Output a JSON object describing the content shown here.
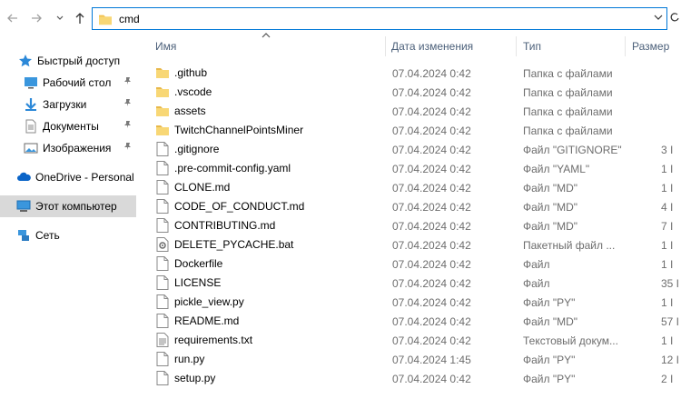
{
  "address": {
    "path": "cmd"
  },
  "nav": {
    "back_icon": "arrow-left-icon",
    "forward_icon": "arrow-right-icon",
    "recent_icon": "chevron-down-icon",
    "up_icon": "arrow-up-icon"
  },
  "sidebar": {
    "items": [
      {
        "label": "Быстрый доступ",
        "icon": "star-icon"
      },
      {
        "label": "Рабочий стол",
        "icon": "desktop-icon"
      },
      {
        "label": "Загрузки",
        "icon": "download-icon"
      },
      {
        "label": "Документы",
        "icon": "documents-icon"
      },
      {
        "label": "Изображения",
        "icon": "pictures-icon"
      },
      {
        "label": "OneDrive - Personal",
        "icon": "cloud-icon"
      },
      {
        "label": "Этот компьютер",
        "icon": "computer-icon"
      },
      {
        "label": "Сеть",
        "icon": "network-icon"
      }
    ]
  },
  "columns": {
    "name": "Имя",
    "date": "Дата изменения",
    "type": "Тип",
    "size": "Размер"
  },
  "files": [
    {
      "name": ".github",
      "date": "07.04.2024 0:42",
      "type": "Папка с файлами",
      "size": "",
      "kind": "folder"
    },
    {
      "name": ".vscode",
      "date": "07.04.2024 0:42",
      "type": "Папка с файлами",
      "size": "",
      "kind": "folder"
    },
    {
      "name": "assets",
      "date": "07.04.2024 0:42",
      "type": "Папка с файлами",
      "size": "",
      "kind": "folder"
    },
    {
      "name": "TwitchChannelPointsMiner",
      "date": "07.04.2024 0:42",
      "type": "Папка с файлами",
      "size": "",
      "kind": "folder"
    },
    {
      "name": ".gitignore",
      "date": "07.04.2024 0:42",
      "type": "Файл \"GITIGNORE\"",
      "size": "3 I",
      "kind": "file"
    },
    {
      "name": ".pre-commit-config.yaml",
      "date": "07.04.2024 0:42",
      "type": "Файл \"YAML\"",
      "size": "1 I",
      "kind": "file"
    },
    {
      "name": "CLONE.md",
      "date": "07.04.2024 0:42",
      "type": "Файл \"MD\"",
      "size": "1 I",
      "kind": "file"
    },
    {
      "name": "CODE_OF_CONDUCT.md",
      "date": "07.04.2024 0:42",
      "type": "Файл \"MD\"",
      "size": "4 I",
      "kind": "file"
    },
    {
      "name": "CONTRIBUTING.md",
      "date": "07.04.2024 0:42",
      "type": "Файл \"MD\"",
      "size": "7 I",
      "kind": "file"
    },
    {
      "name": "DELETE_PYCACHE.bat",
      "date": "07.04.2024 0:42",
      "type": "Пакетный файл ...",
      "size": "1 I",
      "kind": "bat"
    },
    {
      "name": "Dockerfile",
      "date": "07.04.2024 0:42",
      "type": "Файл",
      "size": "1 I",
      "kind": "file"
    },
    {
      "name": "LICENSE",
      "date": "07.04.2024 0:42",
      "type": "Файл",
      "size": "35 I",
      "kind": "file"
    },
    {
      "name": "pickle_view.py",
      "date": "07.04.2024 0:42",
      "type": "Файл \"PY\"",
      "size": "1 I",
      "kind": "file"
    },
    {
      "name": "README.md",
      "date": "07.04.2024 0:42",
      "type": "Файл \"MD\"",
      "size": "57 I",
      "kind": "file"
    },
    {
      "name": "requirements.txt",
      "date": "07.04.2024 0:42",
      "type": "Текстовый докум...",
      "size": "1 I",
      "kind": "txt"
    },
    {
      "name": "run.py",
      "date": "07.04.2024 1:45",
      "type": "Файл \"PY\"",
      "size": "12 I",
      "kind": "file"
    },
    {
      "name": "setup.py",
      "date": "07.04.2024 0:42",
      "type": "Файл \"PY\"",
      "size": "2 I",
      "kind": "file"
    }
  ],
  "colors": {
    "accent": "#0078d7",
    "folder": "#f2c14e",
    "selected": "#d9d9d9",
    "header_text": "#4c607a"
  }
}
